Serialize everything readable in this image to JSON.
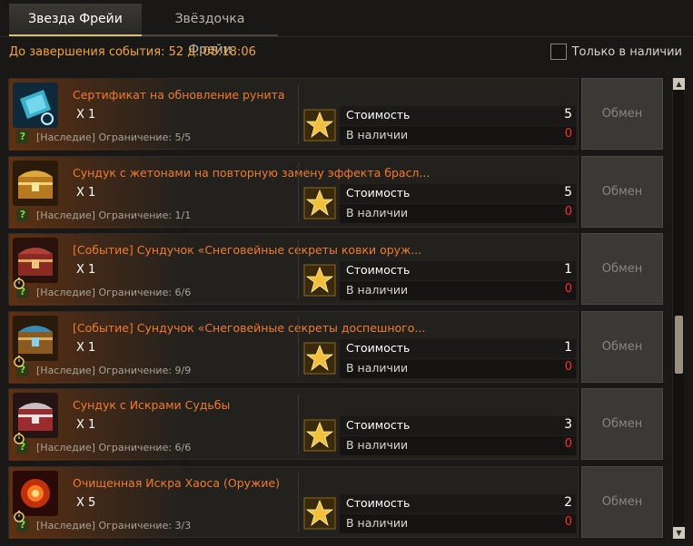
{
  "tabs": [
    {
      "label": "Звезда Фрейи",
      "active": true
    },
    {
      "label": "Звёздочка Фрейи",
      "active": false
    }
  ],
  "event_timer": "До завершения события: 52 д. 08:18:06",
  "in_stock_filter": {
    "label": "Только в наличии",
    "checked": false
  },
  "labels": {
    "cost": "Стоимость",
    "in_stock": "В наличии",
    "exchange": "Обмен",
    "help": "?"
  },
  "colors": {
    "title": "#f07a30",
    "timer": "#f0a830",
    "insufficient": "#ff2a2a"
  },
  "items": [
    {
      "title": "Сертификат на обновление рунита",
      "qty": "X 1",
      "limit": "[Наследие] Ограничение: 5/5",
      "cost": "5",
      "in_stock": "0",
      "icon": "rune-certificate-icon",
      "timed": false
    },
    {
      "title": "Сундук с жетонами на повторную замену эффекта брасл...",
      "qty": "X 1",
      "limit": "[Наследие] Ограничение: 1/1",
      "cost": "5",
      "in_stock": "0",
      "icon": "gold-chest-icon",
      "timed": false
    },
    {
      "title": "[Событие] Сундучок «Снеговейные секреты ковки оруж...",
      "qty": "X 1",
      "limit": "[Наследие] Ограничение: 6/6",
      "cost": "1",
      "in_stock": "0",
      "icon": "red-chest-icon",
      "timed": true
    },
    {
      "title": "[Событие] Сундучок «Снеговейные секреты доспешного...",
      "qty": "X 1",
      "limit": "[Наследие] Ограничение: 9/9",
      "cost": "1",
      "in_stock": "0",
      "icon": "blue-chest-icon",
      "timed": true
    },
    {
      "title": "Сундук с Искрами Судьбы",
      "qty": "X 1",
      "limit": "[Наследие] Ограничение: 6/6",
      "cost": "3",
      "in_stock": "0",
      "icon": "red-silver-chest-icon",
      "timed": true
    },
    {
      "title": "Очищенная Искра Хаоса (Оружие)",
      "qty": "X 5",
      "limit": "[Наследие] Ограничение: 3/3",
      "cost": "2",
      "in_stock": "0",
      "icon": "chaos-spark-icon",
      "timed": true
    }
  ],
  "scrollbar": {
    "position": 0.5
  }
}
